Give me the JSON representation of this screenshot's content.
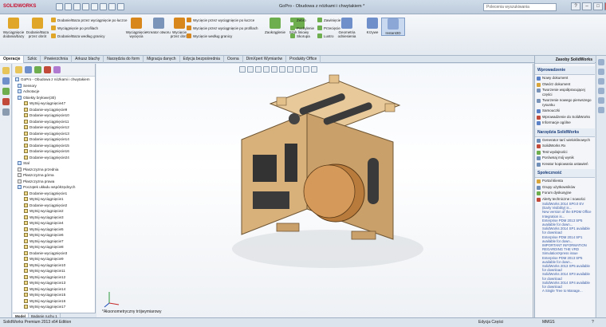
{
  "app": {
    "logo": "SOLIDWORKS",
    "doc_title": "GoPro - Obudowa z nóżkami i chwytakiem *",
    "search_placeholder": "Polecenia wyszukiwania"
  },
  "ribbon": {
    "big": [
      {
        "label": "Wyciągnięcie dodania/bazy",
        "color": "#e0a62a"
      },
      {
        "label": "Dodanie/Baza przez obrót",
        "color": "#e0a62a"
      },
      {
        "label": "Wyciągnięcie wycięcia",
        "color": "#d7871c"
      },
      {
        "label": "Kreator otworu",
        "color": "#7a93b8"
      },
      {
        "label": "Wycięcie przez obrót",
        "color": "#d7871c"
      },
      {
        "label": "Zaokrąglenie",
        "color": "#6fae4e"
      },
      {
        "label": "Szyk liniowy",
        "color": "#6fae4e"
      },
      {
        "label": "Geometria odniesienia",
        "color": "#6e8fc9"
      },
      {
        "label": "Krzywe",
        "color": "#6e8fc9"
      },
      {
        "label": "Instant3D",
        "color": "#8ca6d6"
      }
    ],
    "small": [
      {
        "label": "Dodanie/Baza przez wyciągnięcie po łuczce",
        "color": "#e0a62a"
      },
      {
        "label": "Wyciągnięcie po profilach",
        "color": "#e0a62a"
      },
      {
        "label": "Dodanie/Baza według granicy",
        "color": "#e0a62a"
      },
      {
        "label": "Wycięcie przez wyciągnięcie po łuczce",
        "color": "#d7871c"
      },
      {
        "label": "Wycięcie przez wyciągnięcie po profilach",
        "color": "#d7871c"
      },
      {
        "label": "Wycięcie według granicy",
        "color": "#d7871c"
      },
      {
        "label": "Żebro",
        "color": "#6fae4e"
      },
      {
        "label": "Pochylenie",
        "color": "#6fae4e"
      },
      {
        "label": "Skorupa",
        "color": "#6fae4e"
      },
      {
        "label": "Zawinięcie",
        "color": "#6fae4e"
      },
      {
        "label": "Przecięcie",
        "color": "#6fae4e"
      },
      {
        "label": "Lustro",
        "color": "#6fae4e"
      }
    ]
  },
  "tabs": [
    "Operacje",
    "Szkic",
    "Powierzchnia",
    "Arkusz blachy",
    "Narzędzia do form",
    "Migracja danych",
    "Edycja bezpośrednia",
    "Ocena",
    "DimXpert Wymiarów",
    "Produkty Office"
  ],
  "tree": {
    "root": "GoPro - Obudowa z nóżkami i chwytakiem",
    "items": [
      {
        "label": "Sensory",
        "type": "h"
      },
      {
        "label": "Adnotacje",
        "type": "h"
      },
      {
        "label": "Obiekty bryłowe(30)",
        "type": "h"
      },
      {
        "label": "Wytnij-wyciągnięcie47",
        "type": "b"
      },
      {
        "label": "Dodanie-wyciągnięcie9",
        "type": "b"
      },
      {
        "label": "Dodanie-wyciągnięcie10",
        "type": "b"
      },
      {
        "label": "Dodanie-wyciągnięcie11",
        "type": "b"
      },
      {
        "label": "Dodanie-wyciągnięcie12",
        "type": "b"
      },
      {
        "label": "Dodanie-wyciągnięcie13",
        "type": "b"
      },
      {
        "label": "Dodanie-wyciągnięcie14",
        "type": "b"
      },
      {
        "label": "Dodanie-wyciągnięcie15",
        "type": "b"
      },
      {
        "label": "Dodanie-wyciągnięcie16",
        "type": "b"
      },
      {
        "label": "Dodanie-wyciągnięcie24",
        "type": "b"
      },
      {
        "label": "Stal",
        "type": "h"
      },
      {
        "label": "Płaszczyzna przednia",
        "type": "pl"
      },
      {
        "label": "Płaszczyzna górna",
        "type": "pl"
      },
      {
        "label": "Płaszczyzna prawa",
        "type": "pl"
      },
      {
        "label": "Początek układu współrzędnych",
        "type": "h"
      },
      {
        "label": "Dodanie-wyciągnięcie1",
        "type": "b"
      },
      {
        "label": "Wytnij-wyciągnięcie1",
        "type": "b"
      },
      {
        "label": "Dodanie-wyciągnięcie2",
        "type": "b"
      },
      {
        "label": "Wytnij-wyciągnięcie2",
        "type": "b"
      },
      {
        "label": "Wytnij-wyciągnięcie3",
        "type": "b"
      },
      {
        "label": "Wytnij-wyciągnięcie4",
        "type": "b"
      },
      {
        "label": "Wytnij-wyciągnięcie5",
        "type": "b"
      },
      {
        "label": "Wytnij-wyciągnięcie6",
        "type": "b"
      },
      {
        "label": "Wytnij-wyciągnięcie7",
        "type": "b"
      },
      {
        "label": "Wytnij-wyciągnięcie8",
        "type": "b"
      },
      {
        "label": "Dodanie-wyciągnięcie3",
        "type": "b"
      },
      {
        "label": "Wytnij-wyciągnięcie9",
        "type": "b"
      },
      {
        "label": "Wytnij-wyciągnięcie10",
        "type": "b"
      },
      {
        "label": "Wytnij-wyciągnięcie11",
        "type": "b"
      },
      {
        "label": "Wytnij-wyciągnięcie12",
        "type": "b"
      },
      {
        "label": "Wytnij-wyciągnięcie13",
        "type": "b"
      },
      {
        "label": "Wytnij-wyciągnięcie14",
        "type": "b"
      },
      {
        "label": "Wytnij-wyciągnięcie15",
        "type": "b"
      },
      {
        "label": "Wytnij-wyciągnięcie16",
        "type": "b"
      },
      {
        "label": "Wytnij-wyciągnięcie17",
        "type": "b"
      }
    ],
    "bottom_tabs": [
      "Model",
      "Badanie ruchu 1"
    ]
  },
  "viewport": {
    "view_label": "*Aksonometryczny trójwymiarowy"
  },
  "taskpane": {
    "title": "Zasoby SolidWorks",
    "sections": [
      {
        "title": "Wprowadzenie",
        "items": [
          {
            "label": "Nowy dokument",
            "color": "#5b82c6"
          },
          {
            "label": "Otwórz dokument",
            "color": "#d8a53a"
          },
          {
            "label": "Tworzenie współpracującej części",
            "color": "#7a93b8"
          },
          {
            "label": "Tworzenie nowego pierwszego rysunku",
            "color": "#7a93b8"
          },
          {
            "label": "Samouczki",
            "color": "#5b82c6"
          },
          {
            "label": "Wprowadzenie do SolidWorks",
            "color": "#c14a3a"
          },
          {
            "label": "Informacje ogólne",
            "color": "#5b82c6"
          }
        ]
      },
      {
        "title": "Narzędzia SolidWorks",
        "items": [
          {
            "label": "Generator tarć wieloklinowych",
            "color": "#6f8fb8"
          },
          {
            "label": "SolidWorks Rx",
            "color": "#c14a3a"
          },
          {
            "label": "Test wydajności",
            "color": "#6fae4e"
          },
          {
            "label": "Porównaj mój wynik",
            "color": "#6f8fb8"
          },
          {
            "label": "Kreator kopiowania ustawień",
            "color": "#6f8fb8"
          }
        ]
      },
      {
        "title": "Społeczność",
        "items": [
          {
            "label": "Portal klienta",
            "color": "#d8a53a"
          },
          {
            "label": "Grupy użytkowników",
            "color": "#6f8fb8"
          },
          {
            "label": "Forum dyskusyjne",
            "color": "#6fae4e"
          },
          {
            "label": "Alerty techniczne i nowości",
            "color": "#c14a3a"
          }
        ]
      }
    ],
    "news": [
      "SolidWorks 2014 SP0.0 EV (Early Visibility) is...",
      "New version of the EPDM Office Integration is...",
      "Enterprise PDM 2013 SP5 available for down...",
      "SolidWorks 2014 SP1 available for download",
      "Enterprise PDM 2014 SP1 available for down...",
      "IMPORTANT INFORMATION REGARDING THE VRD",
      "SimulationXpress issue",
      "Enterprise PDM 2013 SP5 available for down...",
      "SolidWorks 2013 SP5 available for download",
      "SolidWorks 2014 SP3 available for download",
      "SolidWorks 2014 SP4 available for download",
      "A Single Tree to Manage..."
    ]
  },
  "status": {
    "app": "SolidWorks Premium 2013 x64 Edition",
    "mode": "Edycja Części",
    "units": "MMGS"
  }
}
